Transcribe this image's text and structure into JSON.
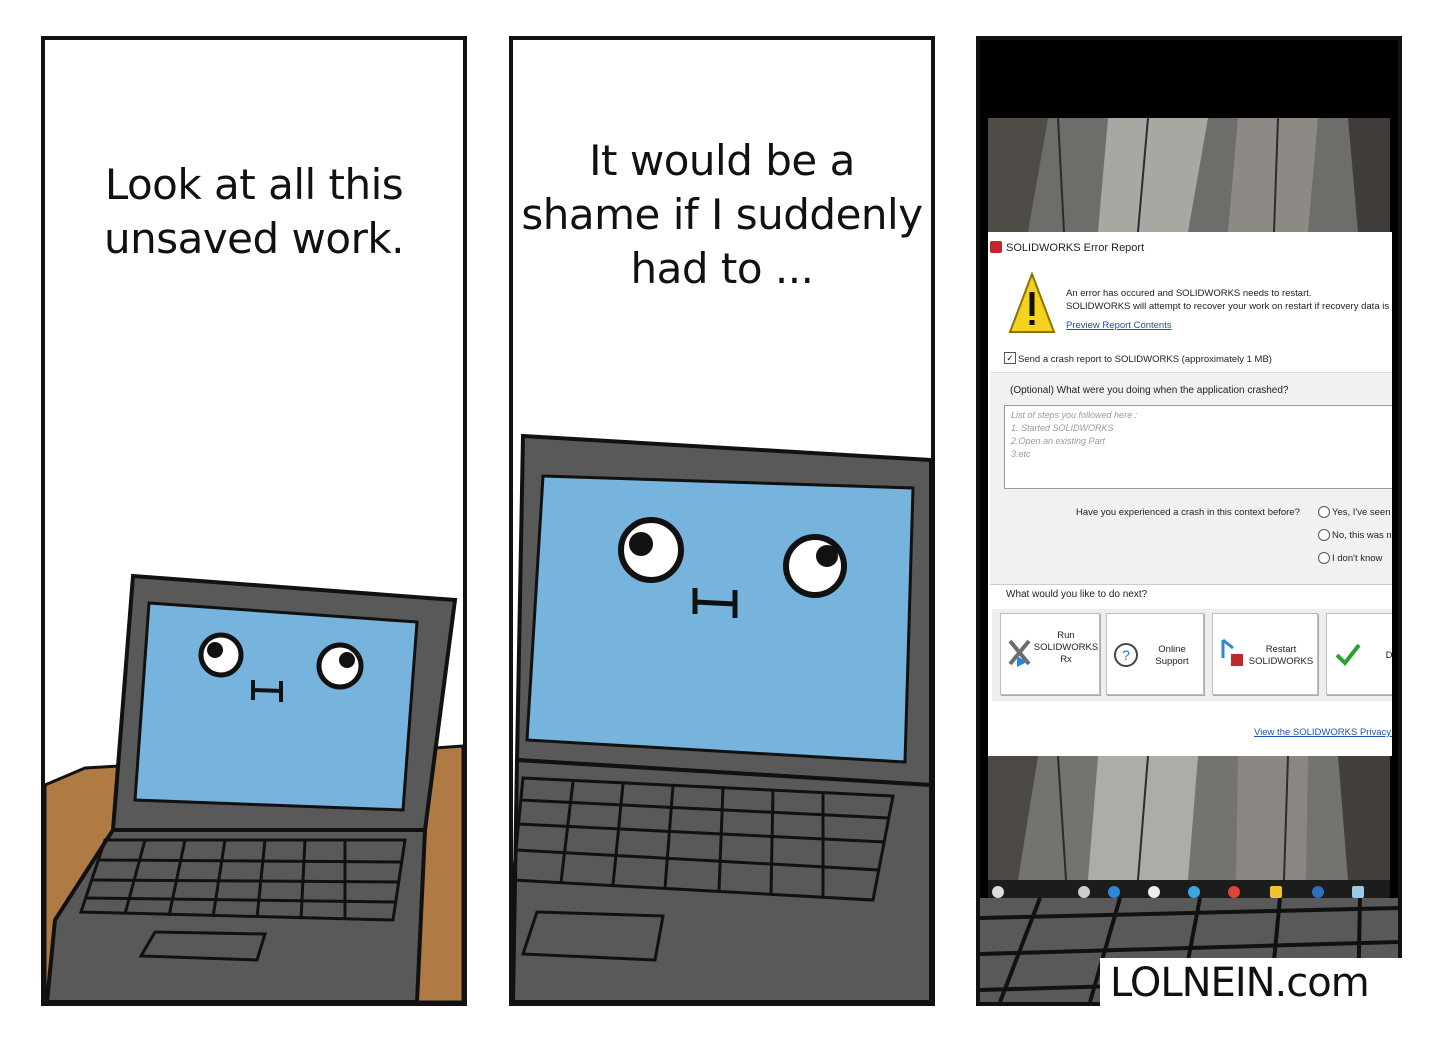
{
  "panel1": {
    "caption": [
      "Look at all this",
      "unsaved work."
    ]
  },
  "panel2": {
    "caption": [
      "It would be a",
      "shame if I suddenly",
      "had to ..."
    ]
  },
  "dialog": {
    "title": "SOLIDWORKS Error Report",
    "message_line1": "An error has occured and SOLIDWORKS needs to restart.",
    "message_line2": "SOLIDWORKS will attempt to recover your work on restart if recovery data is a",
    "preview_link": "Preview Report Contents",
    "send_report_checked": "✓",
    "send_report_label": "Send a crash report to SOLIDWORKS (approximately 1 MB)",
    "optional_question": "(Optional) What were you doing when the application crashed?",
    "placeholder_lines": [
      "List of steps you followed here :",
      "1. Started SOLIDWORKS",
      "2.Open an existing Part",
      "3.etc"
    ],
    "crash_question": "Have you experienced a crash in this context before?",
    "radio_options": [
      "Yes, I've seen it",
      "No, this was n",
      "I don't know"
    ],
    "next_question": "What would you like to do next?",
    "actions": {
      "rx": [
        "Run",
        "SOLIDWORKS",
        "Rx"
      ],
      "support": [
        "Online",
        "Support"
      ],
      "restart": [
        "Restart",
        "SOLIDWORKS"
      ],
      "done": "D"
    },
    "privacy_link": "View the SOLIDWORKS Privacy Po"
  },
  "colors": {
    "screen_blue": "#76b3dd",
    "laptop_gray": "#595959",
    "desk_brown": "#b07a45",
    "link_blue": "#1f4fb4",
    "warning_yellow": "#f4d21f"
  },
  "watermark": "LOLNEIN.com"
}
